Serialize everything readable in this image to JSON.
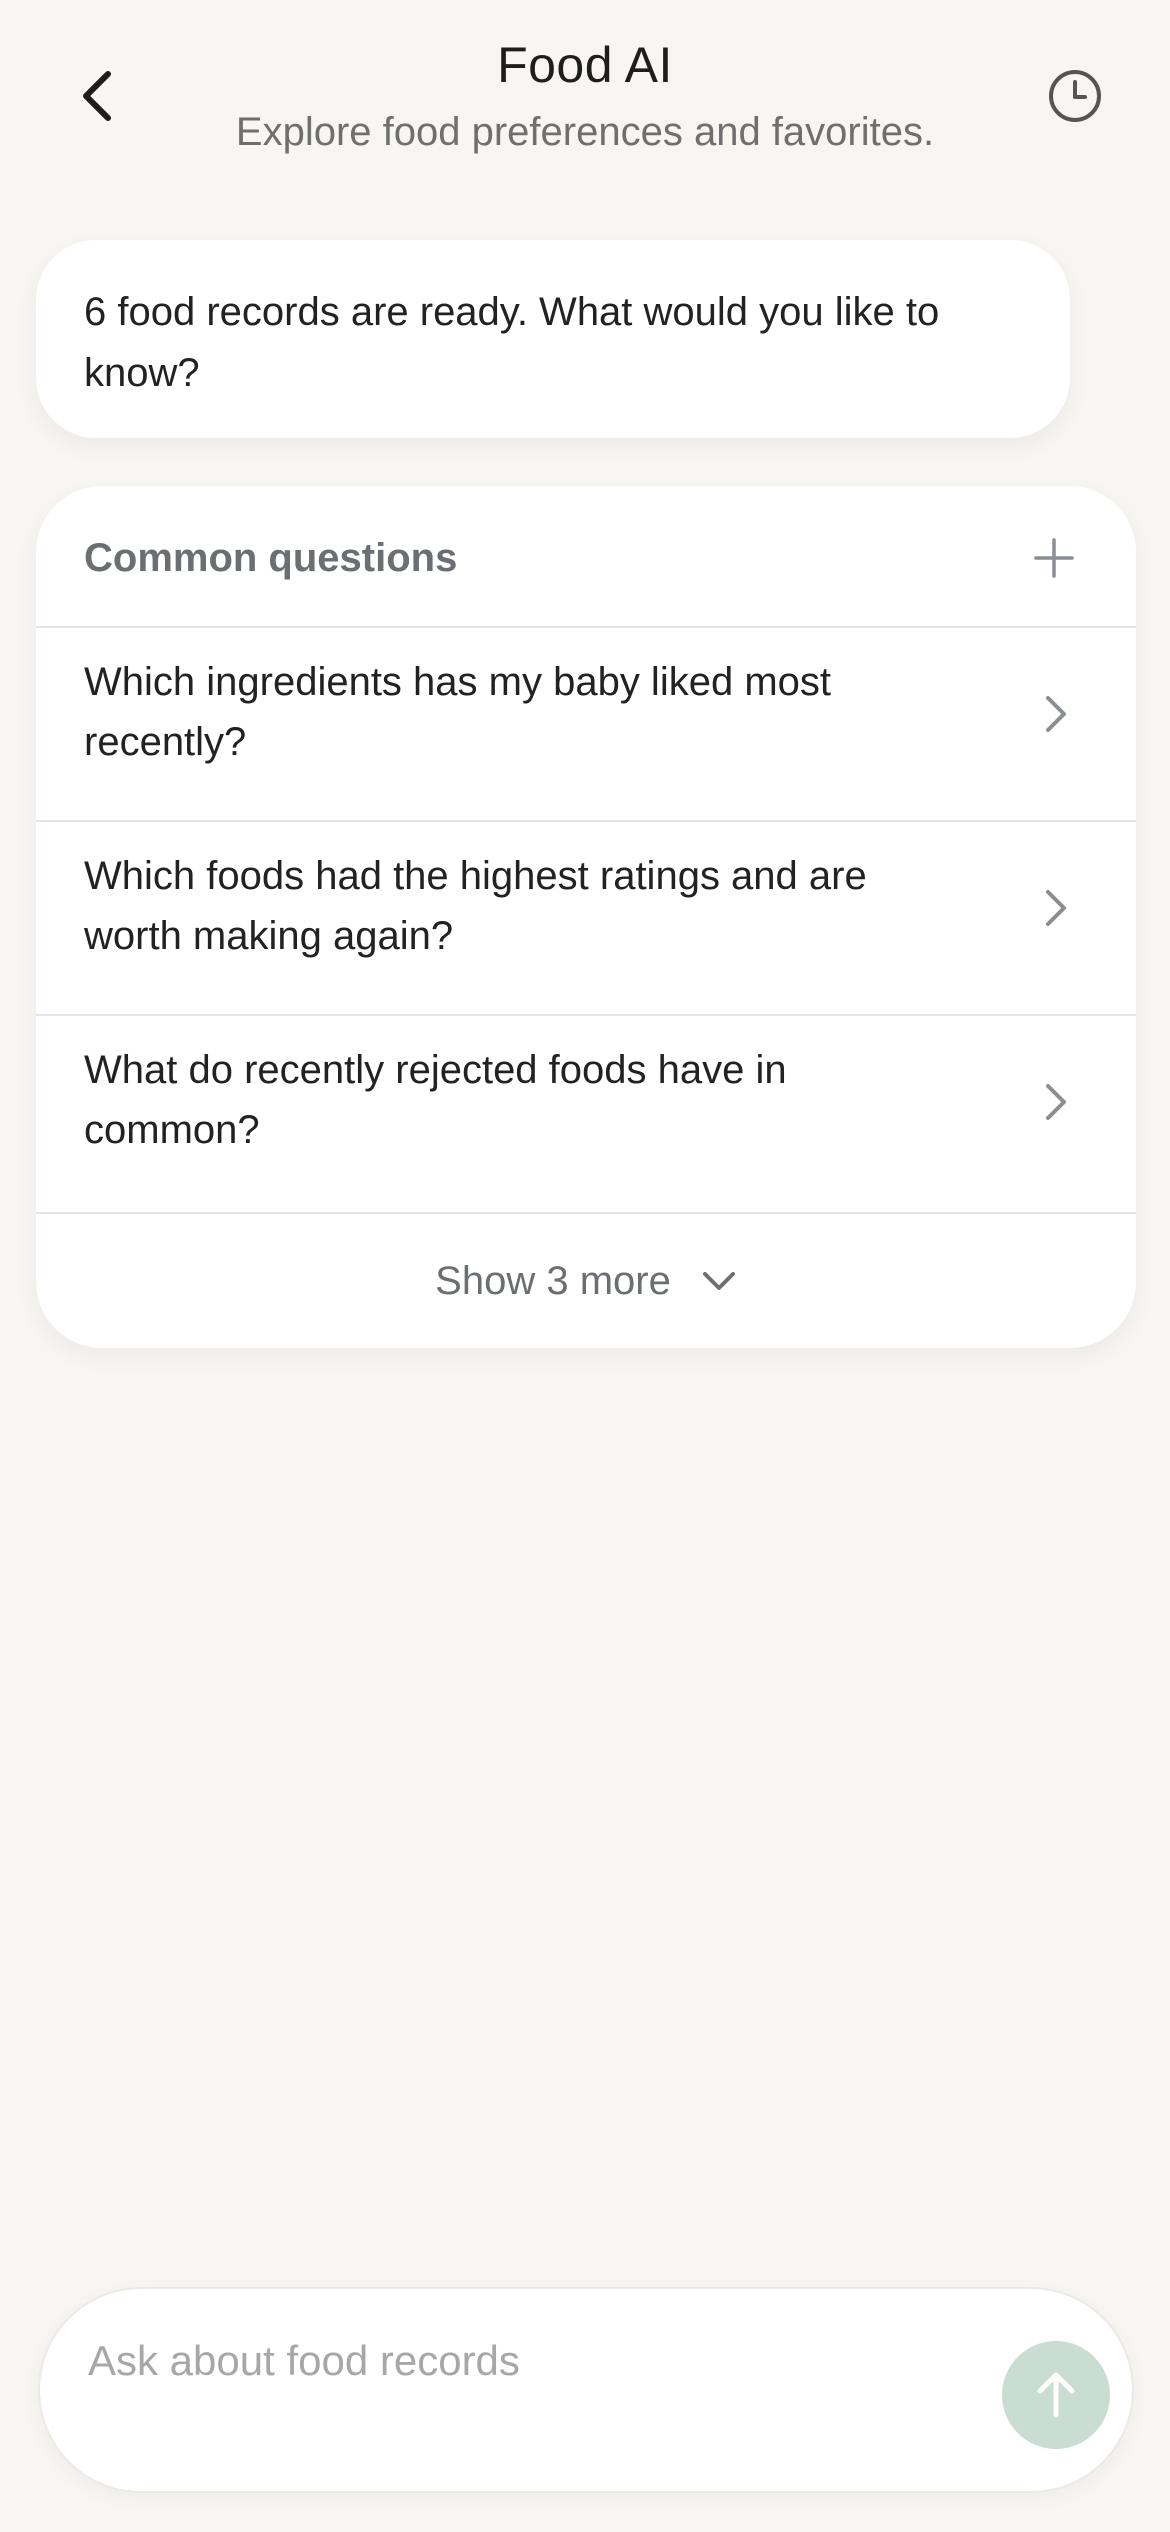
{
  "header": {
    "title": "Food AI",
    "subtitle": "Explore food preferences and favorites.",
    "back_icon": "chevron-left-icon",
    "history_icon": "clock-icon"
  },
  "greeting": {
    "text": "6 food records are ready. What would you like to know?"
  },
  "common_questions": {
    "title": "Common questions",
    "add_icon": "plus-icon",
    "items": [
      {
        "label": "Which ingredients has my baby liked most recently?"
      },
      {
        "label": "Which foods had the highest ratings and are worth making again?"
      },
      {
        "label": "What do recently rejected foods have in common?"
      }
    ],
    "show_more_label": "Show 3 more"
  },
  "composer": {
    "placeholder": "Ask about food records",
    "send_icon": "arrow-up-icon"
  },
  "colors": {
    "background": "#f8f6f3",
    "card": "#ffffff",
    "send_button": "#c9ddd3",
    "muted_text": "#6b6e72"
  }
}
